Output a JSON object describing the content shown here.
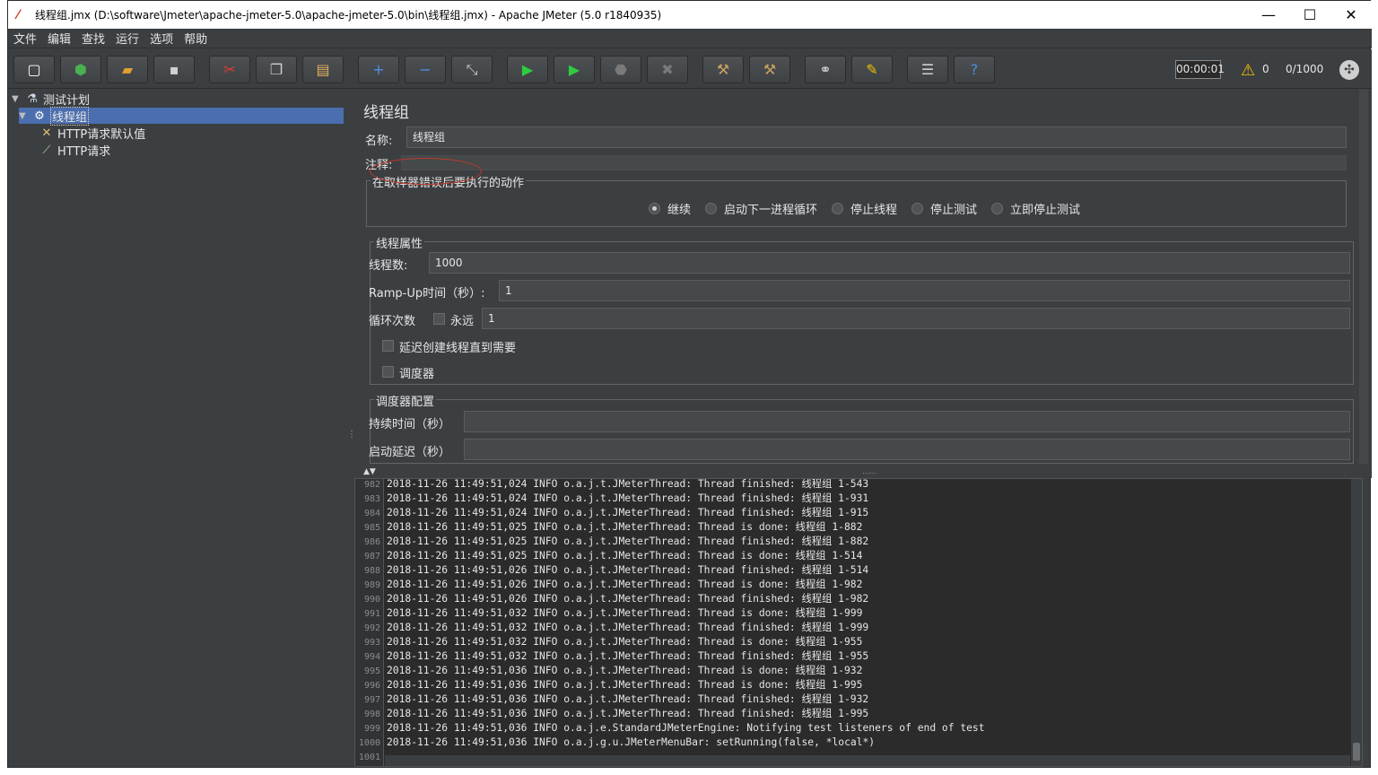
{
  "window": {
    "title": "线程组.jmx (D:\\software\\Jmeter\\apache-jmeter-5.0\\apache-jmeter-5.0\\bin\\线程组.jmx) - Apache JMeter (5.0 r1840935)",
    "minimize": "—",
    "maximize": "☐",
    "close": "✕"
  },
  "menu": [
    "文件",
    "编辑",
    "查找",
    "运行",
    "选项",
    "帮助"
  ],
  "toolbar": {
    "buttons": [
      {
        "name": "new-icon",
        "glyph": "▢",
        "color": "#ffffff"
      },
      {
        "name": "templates-icon",
        "glyph": "⬢",
        "color": "#4caf50"
      },
      {
        "name": "open-icon",
        "glyph": "▰",
        "color": "#e0a030"
      },
      {
        "name": "save-icon",
        "glyph": "▪",
        "color": "#d0d0d0"
      },
      {
        "name": "cut-icon",
        "glyph": "✂",
        "color": "#e53935"
      },
      {
        "name": "copy-icon",
        "glyph": "❐",
        "color": "#d0d0d0"
      },
      {
        "name": "paste-icon",
        "glyph": "▤",
        "color": "#e0b060"
      },
      {
        "name": "expand-icon",
        "glyph": "+",
        "color": "#4a90e2"
      },
      {
        "name": "collapse-icon",
        "glyph": "−",
        "color": "#4a90e2"
      },
      {
        "name": "toggle-icon",
        "glyph": "⤡",
        "color": "#cfcfcf"
      },
      {
        "name": "start-icon",
        "glyph": "▶",
        "color": "#2ecc40"
      },
      {
        "name": "start-no-pause-icon",
        "glyph": "▶",
        "color": "#2ecc40"
      },
      {
        "name": "stop-icon",
        "glyph": "⬣",
        "color": "#7a7a7a"
      },
      {
        "name": "shutdown-icon",
        "glyph": "✖",
        "color": "#7a7a7a"
      },
      {
        "name": "clear-icon",
        "glyph": "⚒",
        "color": "#c8a060"
      },
      {
        "name": "clear-all-icon",
        "glyph": "⚒",
        "color": "#c8a060"
      },
      {
        "name": "search-icon",
        "glyph": "⚭",
        "color": "#d0d0d0"
      },
      {
        "name": "reset-search-icon",
        "glyph": "✎",
        "color": "#f0c000"
      },
      {
        "name": "function-helper-icon",
        "glyph": "☰",
        "color": "#d0d0d0"
      },
      {
        "name": "help-icon",
        "glyph": "?",
        "color": "#4a90e2"
      }
    ],
    "timer": "00:00:01",
    "warning_count": "0",
    "threads": "0/1000"
  },
  "tree": {
    "items": [
      {
        "label": "测试计划",
        "icon": "flask-icon"
      },
      {
        "label": "线程组",
        "icon": "gear-icon"
      },
      {
        "label": "HTTP请求默认值",
        "icon": "wrench-icon"
      },
      {
        "label": "HTTP请求",
        "icon": "pipette-icon"
      }
    ]
  },
  "panel": {
    "title": "线程组",
    "name_label": "名称:",
    "name_value": "线程组",
    "comment_label": "注释:",
    "comment_value": "",
    "error_group": {
      "legend": "在取样器错误后要执行的动作",
      "options": [
        "继续",
        "启动下一进程循环",
        "停止线程",
        "停止测试",
        "立即停止测试"
      ],
      "selected": "继续"
    },
    "thread_props": {
      "legend": "线程属性",
      "threads_label": "线程数:",
      "threads_value": "1000",
      "rampup_label": "Ramp-Up时间（秒）:",
      "rampup_value": "1",
      "loop_label": "循环次数",
      "forever_label": "永远",
      "loop_value": "1",
      "delay_label": "延迟创建线程直到需要",
      "scheduler_label": "调度器"
    },
    "scheduler_config": {
      "legend": "调度器配置",
      "duration_label": "持续时间（秒）",
      "duration_value": "",
      "startup_delay_label": "启动延迟（秒）",
      "startup_delay_value": ""
    }
  },
  "log": [
    {
      "n": "982",
      "t": "2018-11-26 11:49:51,024 INFO o.a.j.t.JMeterThread: Thread finished: 线程组 1-543"
    },
    {
      "n": "983",
      "t": "2018-11-26 11:49:51,024 INFO o.a.j.t.JMeterThread: Thread finished: 线程组 1-931"
    },
    {
      "n": "984",
      "t": "2018-11-26 11:49:51,024 INFO o.a.j.t.JMeterThread: Thread finished: 线程组 1-915"
    },
    {
      "n": "985",
      "t": "2018-11-26 11:49:51,025 INFO o.a.j.t.JMeterThread: Thread is done: 线程组 1-882"
    },
    {
      "n": "986",
      "t": "2018-11-26 11:49:51,025 INFO o.a.j.t.JMeterThread: Thread finished: 线程组 1-882"
    },
    {
      "n": "987",
      "t": "2018-11-26 11:49:51,025 INFO o.a.j.t.JMeterThread: Thread is done: 线程组 1-514"
    },
    {
      "n": "988",
      "t": "2018-11-26 11:49:51,026 INFO o.a.j.t.JMeterThread: Thread finished: 线程组 1-514"
    },
    {
      "n": "989",
      "t": "2018-11-26 11:49:51,026 INFO o.a.j.t.JMeterThread: Thread is done: 线程组 1-982"
    },
    {
      "n": "990",
      "t": "2018-11-26 11:49:51,026 INFO o.a.j.t.JMeterThread: Thread finished: 线程组 1-982"
    },
    {
      "n": "991",
      "t": "2018-11-26 11:49:51,032 INFO o.a.j.t.JMeterThread: Thread is done: 线程组 1-999"
    },
    {
      "n": "992",
      "t": "2018-11-26 11:49:51,032 INFO o.a.j.t.JMeterThread: Thread finished: 线程组 1-999"
    },
    {
      "n": "993",
      "t": "2018-11-26 11:49:51,032 INFO o.a.j.t.JMeterThread: Thread is done: 线程组 1-955"
    },
    {
      "n": "994",
      "t": "2018-11-26 11:49:51,032 INFO o.a.j.t.JMeterThread: Thread finished: 线程组 1-955"
    },
    {
      "n": "995",
      "t": "2018-11-26 11:49:51,036 INFO o.a.j.t.JMeterThread: Thread is done: 线程组 1-932"
    },
    {
      "n": "996",
      "t": "2018-11-26 11:49:51,036 INFO o.a.j.t.JMeterThread: Thread is done: 线程组 1-995"
    },
    {
      "n": "997",
      "t": "2018-11-26 11:49:51,036 INFO o.a.j.t.JMeterThread: Thread finished: 线程组 1-932"
    },
    {
      "n": "998",
      "t": "2018-11-26 11:49:51,036 INFO o.a.j.t.JMeterThread: Thread finished: 线程组 1-995"
    },
    {
      "n": "999",
      "t": "2018-11-26 11:49:51,036 INFO o.a.j.e.StandardJMeterEngine: Notifying test listeners of end of test"
    },
    {
      "n": "1000",
      "t": "2018-11-26 11:49:51,036 INFO o.a.j.g.u.JMeterMenuBar: setRunning(false, *local*)"
    },
    {
      "n": "1001",
      "t": ""
    }
  ]
}
